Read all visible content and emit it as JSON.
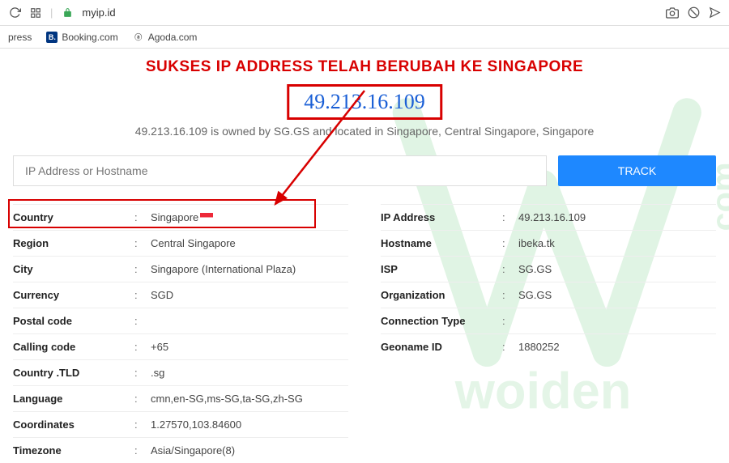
{
  "browser": {
    "url": "myip.id"
  },
  "bookmarks": {
    "item0": "press",
    "item1": "Booking.com",
    "item2": "Agoda.com"
  },
  "banner": "SUKSES IP ADDRESS TELAH BERUBAH KE SINGAPORE",
  "ip_display": "49.213.16.109",
  "subline": "49.213.16.109 is owned by SG.GS and located in Singapore, Central Singapore, Singapore",
  "search": {
    "placeholder": "IP Address or Hostname",
    "track_label": "TRACK"
  },
  "left": {
    "country": {
      "label": "Country",
      "value": "Singapore"
    },
    "region": {
      "label": "Region",
      "value": "Central Singapore"
    },
    "city": {
      "label": "City",
      "value": "Singapore (International Plaza)"
    },
    "currency": {
      "label": "Currency",
      "value": "SGD"
    },
    "postal": {
      "label": "Postal code",
      "value": ""
    },
    "calling": {
      "label": "Calling code",
      "value": "+65"
    },
    "tld": {
      "label": "Country .TLD",
      "value": ".sg"
    },
    "language": {
      "label": "Language",
      "value": "cmn,en-SG,ms-SG,ta-SG,zh-SG"
    },
    "coords": {
      "label": "Coordinates",
      "value": "1.27570,103.84600"
    },
    "timezone": {
      "label": "Timezone",
      "value": "Asia/Singapore(8)"
    }
  },
  "right": {
    "ip": {
      "label": "IP Address",
      "value": "49.213.16.109"
    },
    "hostname": {
      "label": "Hostname",
      "value": "ibeka.tk"
    },
    "isp": {
      "label": "ISP",
      "value": "SG.GS"
    },
    "org": {
      "label": "Organization",
      "value": "SG.GS"
    },
    "conn": {
      "label": "Connection Type",
      "value": ""
    },
    "geo": {
      "label": "Geoname ID",
      "value": "1880252"
    }
  }
}
